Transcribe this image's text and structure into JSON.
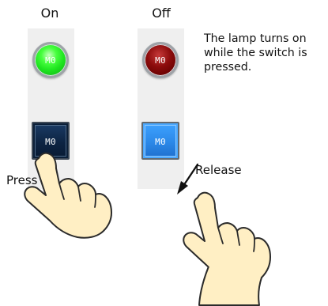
{
  "labels": {
    "on": "On",
    "off": "Off",
    "press": "Press",
    "release": "Release"
  },
  "lamp_on": {
    "text": "M0",
    "state": "lit",
    "color": "#36f22f"
  },
  "lamp_off": {
    "text": "M0",
    "state": "unlit",
    "color": "#8b0d0d"
  },
  "switch_on": {
    "text": "M0",
    "state": "pressed",
    "color": "#0d2443"
  },
  "switch_off": {
    "text": "M0",
    "state": "released",
    "color": "#2b88e8"
  },
  "caption": "The lamp turns on\nwhile the switch is\npressed.",
  "icons": {
    "press_hand": "pointing-hand-icon",
    "release_hand": "pointing-hand-icon",
    "release_arrow": "arrow-down-left-icon"
  }
}
